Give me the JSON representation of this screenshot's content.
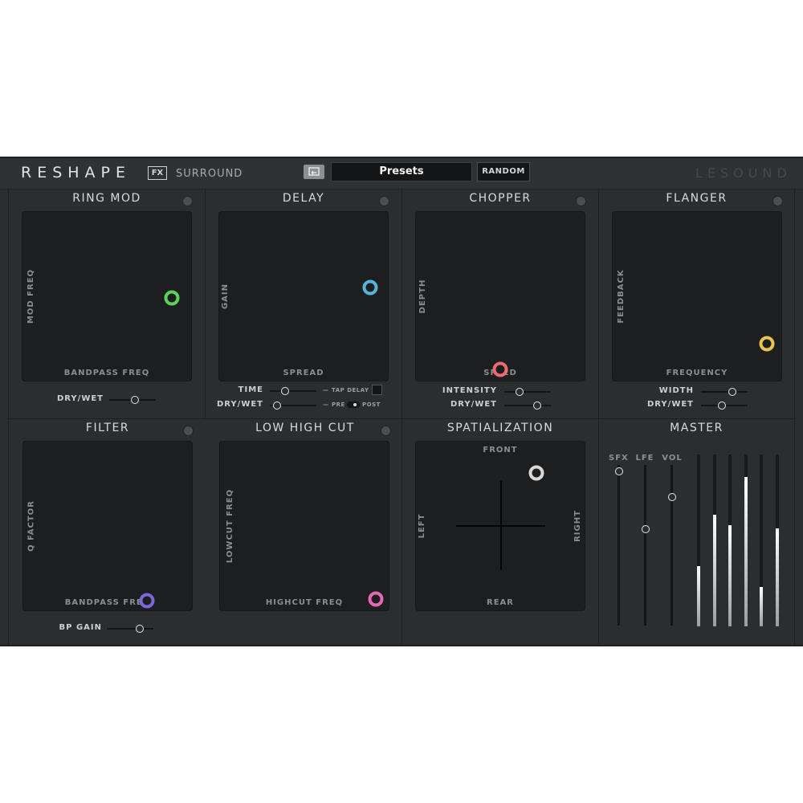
{
  "header": {
    "brand": "RESHAPE",
    "fx_badge": "FX",
    "edition": "SURROUND",
    "preset_label": "Presets",
    "random_label": "RANDOM",
    "vendor": "LESOUND",
    "preset_icon": "preset-load-icon"
  },
  "sections": {
    "ring_mod": {
      "title": "RING MOD",
      "x_label": "BANDPASS FREQ",
      "y_label": "MOD FREQ",
      "handle_color": "#5bd35b",
      "handle": [
        0.88,
        0.51
      ],
      "dry_wet_label": "DRY/WET",
      "dry_wet": 0.55
    },
    "delay": {
      "title": "DELAY",
      "x_label": "SPREAD",
      "y_label": "GAIN",
      "handle_color": "#57b4d9",
      "handle": [
        0.89,
        0.45
      ],
      "time_label": "TIME",
      "time": 0.32,
      "dry_wet_label": "DRY/WET",
      "dry_wet": 0.16,
      "tap_delay_label": "TAP DELAY",
      "pre_label": "PRE",
      "post_label": "POST"
    },
    "chopper": {
      "title": "CHOPPER",
      "x_label": "SPEED",
      "y_label": "DEPTH",
      "handle_color": "#ef6b6b",
      "handle": [
        0.5,
        0.93
      ],
      "intensity_label": "INTENSITY",
      "intensity": 0.33,
      "dry_wet_label": "DRY/WET",
      "dry_wet": 0.7
    },
    "flanger": {
      "title": "FLANGER",
      "x_label": "FREQUENCY",
      "y_label": "FEEDBACK",
      "handle_color": "#e6c650",
      "handle": [
        0.91,
        0.78
      ],
      "width_label": "WIDTH",
      "width": 0.68,
      "dry_wet_label": "DRY/WET",
      "dry_wet": 0.45
    },
    "filter": {
      "title": "FILTER",
      "x_label": "BANDPASS FREQ",
      "y_label": "Q FACTOR",
      "handle_color": "#7a66dd",
      "handle": [
        0.73,
        0.94
      ],
      "bp_gain_label": "BP GAIN",
      "bp_gain": 0.7
    },
    "low_high_cut": {
      "title": "LOW HIGH CUT",
      "x_label": "HIGHCUT FREQ",
      "y_label": "LOWCUT FREQ",
      "handle_color": "#e667b8",
      "handle": [
        0.92,
        0.93
      ]
    },
    "spatialization": {
      "title": "SPATIALIZATION",
      "front_label": "FRONT",
      "rear_label": "REAR",
      "left_label": "LEFT",
      "right_label": "RIGHT",
      "handle_color": "#d8d8d8",
      "handle": [
        0.71,
        0.19
      ]
    },
    "master": {
      "title": "MASTER",
      "sfx_label": "SFX",
      "lfe_label": "LFE",
      "vol_label": "VOL",
      "sfx": 0.96,
      "lfe": 0.6,
      "vol": 0.8,
      "meters": [
        0.35,
        0.65,
        0.59,
        0.87,
        0.23,
        0.57
      ]
    }
  }
}
